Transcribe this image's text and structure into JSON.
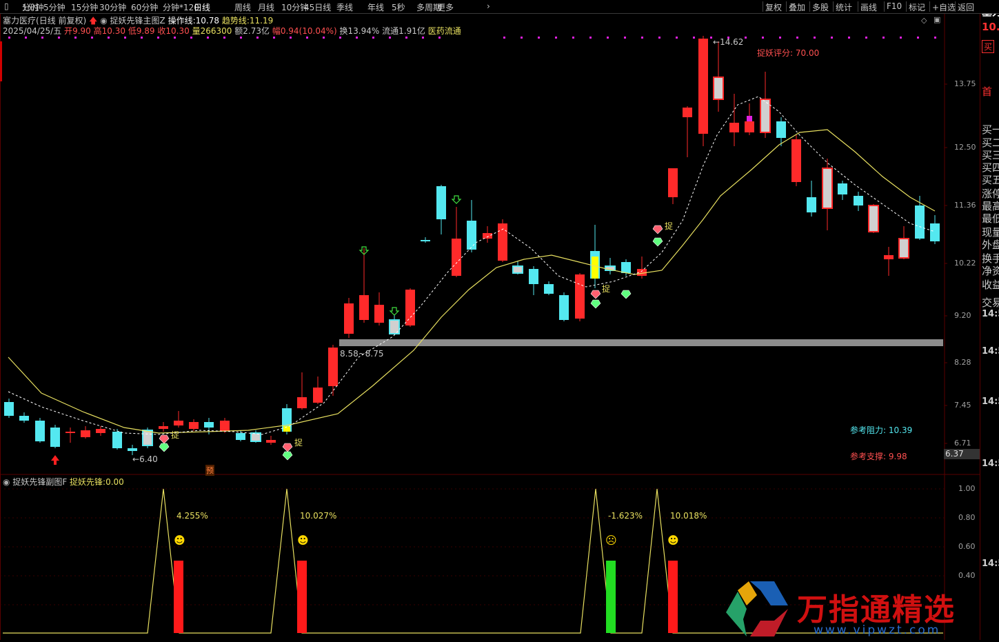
{
  "toolbar": {
    "left_items": [
      "分时",
      "1分钟",
      "5分钟",
      "15分钟",
      "30分钟",
      "60分钟",
      "分钟*120",
      "日线",
      "周线",
      "月线",
      "10分钟",
      "45日线",
      "季线",
      "年线",
      "5秒",
      "多周期",
      "更多"
    ],
    "active": "日线",
    "right_items": [
      "复权",
      "叠加",
      "多股",
      "统计",
      "画线",
      "F10",
      "标记",
      "+自选",
      "返回"
    ]
  },
  "header": {
    "stock_name": "塞力医疗",
    "mode": "(日线 前复权)",
    "indicator_name": "捉妖先锋主图Z",
    "op_line_label": "操作线:",
    "op_line_value": "10.78",
    "trend_line_label": "趋势线:",
    "trend_line_value": "11.19",
    "date": "2025/04/25/五",
    "open_label": "开",
    "open": "9.90",
    "high_label": "高",
    "high": "10.30",
    "low_label": "低",
    "low": "9.89",
    "close_label": "收",
    "close": "10.30",
    "vol_label": "量",
    "vol": "266300",
    "amount_label": "额",
    "amount": "2.73亿",
    "change_label": "幅",
    "change": "0.94(10.04%)",
    "turnover_label": "换",
    "turnover": "13.94%",
    "float_label": "流通",
    "float": "1.91亿",
    "sector": "医药流通"
  },
  "annotations": {
    "peak_label": "14.62",
    "low_label": "6.40",
    "zone_label": "8.58~8.75",
    "score_label": "捉妖评分:",
    "score_value": "70.00",
    "resistance_label": "参考阻力:",
    "resistance_value": "10.39",
    "support_label": "参考支撑:",
    "support_value": "9.98",
    "signal_text": "捉",
    "pre_badge": "预",
    "current_price_tag": "6.37"
  },
  "axis": {
    "price_ticks": [
      "13.75",
      "12.50",
      "11.36",
      "10.22",
      "9.20",
      "8.28",
      "7.45",
      "6.71"
    ],
    "sub_ticks": [
      "1.00",
      "0.80",
      "0.60",
      "0.40"
    ]
  },
  "sub_chart": {
    "name": "捉妖先锋副图F",
    "value_label": "捉妖先锋:",
    "value": "0.00",
    "peaks": [
      {
        "pct": "4.255%",
        "face": "☻",
        "bar_color": "#ff1a1a"
      },
      {
        "pct": "10.027%",
        "face": "☻",
        "bar_color": "#ff1a1a"
      },
      {
        "pct": "-1.623%",
        "face": "☹",
        "bar_color": "#22dd22"
      },
      {
        "pct": "10.018%",
        "face": "☻",
        "bar_color": "#ff1a1a"
      }
    ]
  },
  "right_panel": {
    "items": [
      "塞力",
      "10.",
      "买",
      "首",
      "买一",
      "买二",
      "买三",
      "买四",
      "买五",
      "涨停",
      "最高",
      "最低",
      "现量",
      "外盘",
      "换手",
      "净资",
      "收益",
      "交易",
      "14:5",
      "14:5",
      "14:5",
      "14:5",
      "14:5"
    ]
  },
  "watermark": {
    "text": "万指通精选",
    "url": "www.vipwzt.com"
  },
  "colors": {
    "up": "#ff2a2a",
    "down": "#54e8f0",
    "ma_fast": "#ffffff",
    "ma_slow": "#e8e060",
    "zone": "#8c8c8c",
    "label_yellow": "#e8e060",
    "label_red": "#ff5050",
    "label_cyan": "#54e8f0"
  }
}
